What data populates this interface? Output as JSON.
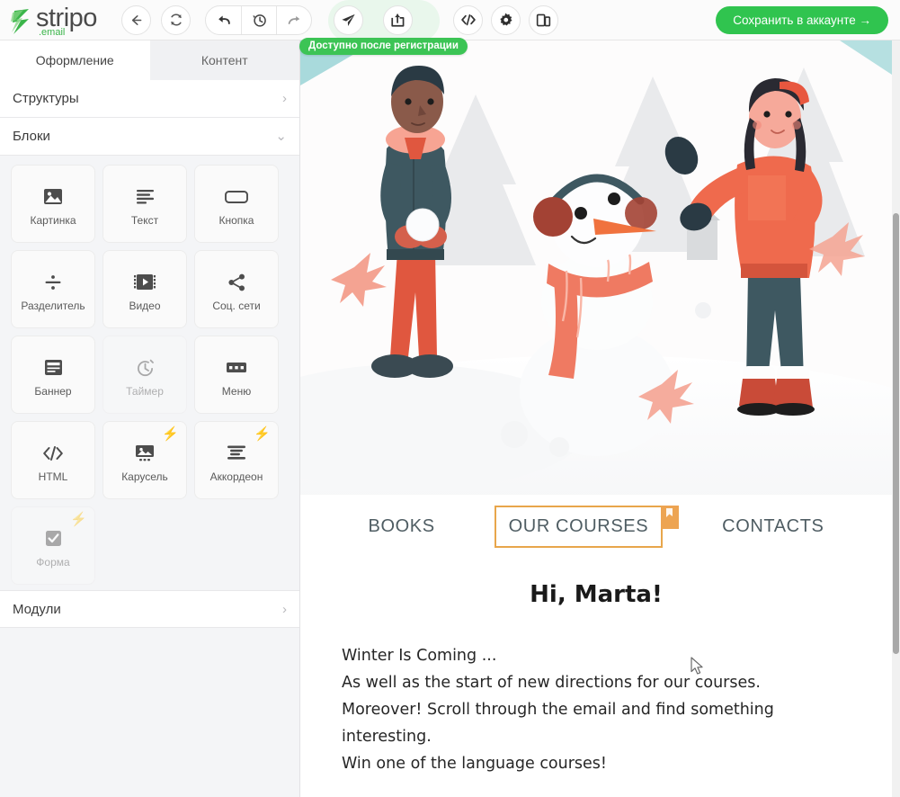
{
  "app": {
    "brand_name": "stripo",
    "brand_sub": ".email",
    "accent_green": "#30c44f",
    "accent_orange": "#e8a64b",
    "accent_blue": "#1f6ff0"
  },
  "toolbar": {
    "back_label": "back-arrow",
    "refresh_label": "refresh",
    "undo_label": "undo",
    "history_label": "history",
    "redo_label": "redo",
    "send_label": "send-test",
    "export_label": "export",
    "code_label": "view-html-code",
    "settings_label": "settings",
    "device_label": "device-preview",
    "tooltip": "Доступно после регистрации",
    "save_button": "Сохранить в аккаунте →"
  },
  "sidebar": {
    "tabs": [
      {
        "label": "Оформление",
        "active": true
      },
      {
        "label": "Контент",
        "active": false
      }
    ],
    "sections": [
      {
        "label": "Структуры",
        "expanded": false,
        "chevron": "›"
      },
      {
        "label": "Блоки",
        "expanded": true,
        "chevron": "⌄"
      },
      {
        "label": "Модули",
        "expanded": false,
        "chevron": "›"
      }
    ],
    "blocks": [
      {
        "label": "Картинка",
        "icon": "image-icon",
        "disabled": false,
        "premium": false
      },
      {
        "label": "Текст",
        "icon": "text-icon",
        "disabled": false,
        "premium": false
      },
      {
        "label": "Кнопка",
        "icon": "button-icon",
        "disabled": false,
        "premium": false
      },
      {
        "label": "Разделитель",
        "icon": "divider-icon",
        "disabled": false,
        "premium": false
      },
      {
        "label": "Видео",
        "icon": "video-icon",
        "disabled": false,
        "premium": false
      },
      {
        "label": "Соц. сети",
        "icon": "share-icon",
        "disabled": false,
        "premium": false
      },
      {
        "label": "Баннер",
        "icon": "banner-icon",
        "disabled": false,
        "premium": false
      },
      {
        "label": "Таймер",
        "icon": "timer-icon",
        "disabled": true,
        "premium": false
      },
      {
        "label": "Меню",
        "icon": "menu-icon",
        "disabled": false,
        "premium": false
      },
      {
        "label": "HTML",
        "icon": "code-icon",
        "disabled": false,
        "premium": false
      },
      {
        "label": "Карусель",
        "icon": "carousel-icon",
        "disabled": false,
        "premium": true
      },
      {
        "label": "Аккордеон",
        "icon": "accordion-icon",
        "disabled": false,
        "premium": true
      },
      {
        "label": "Форма",
        "icon": "form-icon",
        "disabled": true,
        "premium": true
      }
    ]
  },
  "email": {
    "hero_alt": "winter-illustration-kids-snowman",
    "nav": [
      {
        "label": "BOOKS",
        "selected": false
      },
      {
        "label": "OUR COURSES",
        "selected": true
      },
      {
        "label": "CONTACTS",
        "selected": false
      }
    ],
    "greeting": "Hi, Marta!",
    "body_lines": [
      "Winter Is Coming ...",
      "As well as the start of new directions for our courses.",
      "Moreover! Scroll through the email and find something",
      "interesting.",
      "Win one of the language courses!"
    ]
  }
}
